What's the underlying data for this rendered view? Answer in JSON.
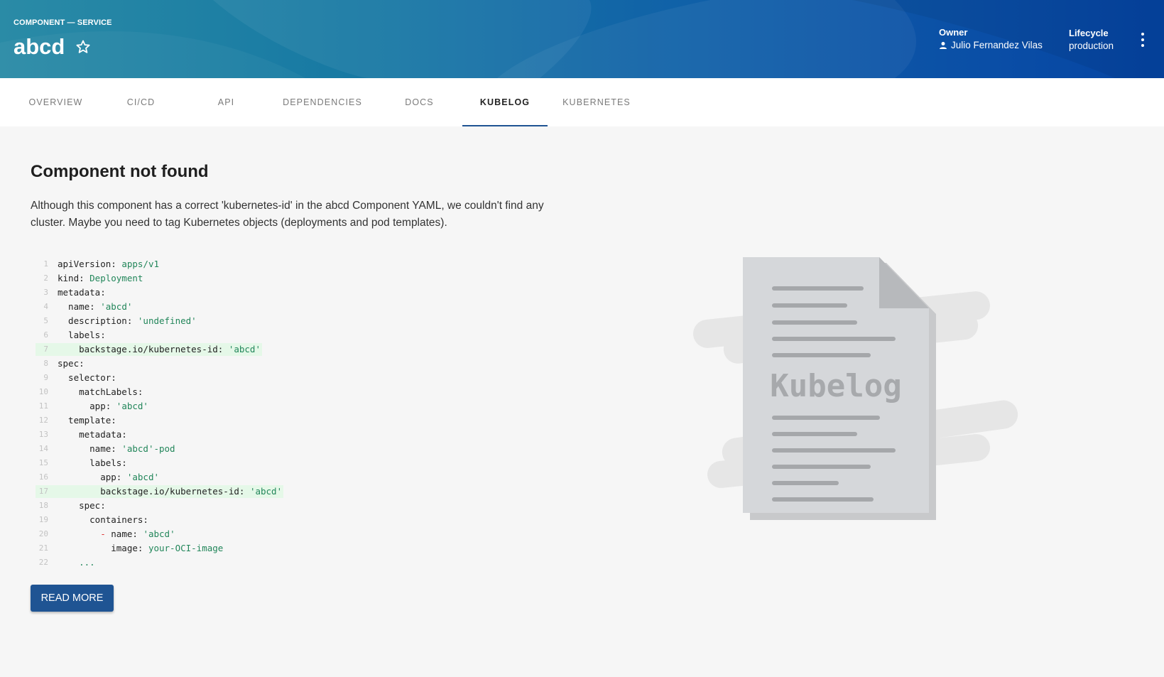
{
  "header": {
    "kind": "COMPONENT — SERVICE",
    "title": "abcd",
    "owner_label": "Owner",
    "owner_value": "Julio Fernandez Vilas",
    "lifecycle_label": "Lifecycle",
    "lifecycle_value": "production"
  },
  "tabs": [
    {
      "label": "OVERVIEW"
    },
    {
      "label": "CI/CD"
    },
    {
      "label": "API"
    },
    {
      "label": "DEPENDENCIES"
    },
    {
      "label": "DOCS"
    },
    {
      "label": "KUBELOG",
      "active": true
    },
    {
      "label": "KUBERNETES"
    }
  ],
  "content": {
    "heading": "Component not found",
    "description": "Although this component has a correct 'kubernetes-id' in the abcd Component YAML, we couldn't find any cluster. Maybe you need to tag Kubernetes objects (deployments and pod templates).",
    "read_more": "READ MORE",
    "illustration_text": "Kubelog"
  },
  "code_lines": [
    {
      "n": "1",
      "key": "apiVersion: ",
      "val": "apps/v1"
    },
    {
      "n": "2",
      "key": "kind: ",
      "val": "Deployment"
    },
    {
      "n": "3",
      "key": "metadata:",
      "val": ""
    },
    {
      "n": "4",
      "key": "  name: ",
      "val": "'abcd'"
    },
    {
      "n": "5",
      "key": "  description: ",
      "val": "'undefined'"
    },
    {
      "n": "6",
      "key": "  labels:",
      "val": ""
    },
    {
      "n": "7",
      "key": "    backstage.io/kubernetes-id: ",
      "val": "'abcd'",
      "hl": true
    },
    {
      "n": "8",
      "key": "spec:",
      "val": ""
    },
    {
      "n": "9",
      "key": "  selector:",
      "val": ""
    },
    {
      "n": "10",
      "key": "    matchLabels:",
      "val": ""
    },
    {
      "n": "11",
      "key": "      app: ",
      "val": "'abcd'"
    },
    {
      "n": "12",
      "key": "  template:",
      "val": ""
    },
    {
      "n": "13",
      "key": "    metadata:",
      "val": ""
    },
    {
      "n": "14",
      "key": "      name: ",
      "val": "'abcd'-pod"
    },
    {
      "n": "15",
      "key": "      labels:",
      "val": ""
    },
    {
      "n": "16",
      "key": "        app: ",
      "val": "'abcd'"
    },
    {
      "n": "17",
      "key": "        backstage.io/kubernetes-id: ",
      "val": "'abcd'",
      "hl": true
    },
    {
      "n": "18",
      "key": "    spec:",
      "val": ""
    },
    {
      "n": "19",
      "key": "      containers:",
      "val": ""
    },
    {
      "n": "20",
      "key": "        ",
      "dash": "- ",
      "key2": "name: ",
      "val": "'abcd'"
    },
    {
      "n": "21",
      "key": "          image: ",
      "val": "your-OCI-image"
    },
    {
      "n": "22",
      "key": "    ",
      "val": "..."
    }
  ],
  "colors": {
    "accent": "#1f5493",
    "string": "#22865a",
    "highlight": "#e5f8e8"
  }
}
